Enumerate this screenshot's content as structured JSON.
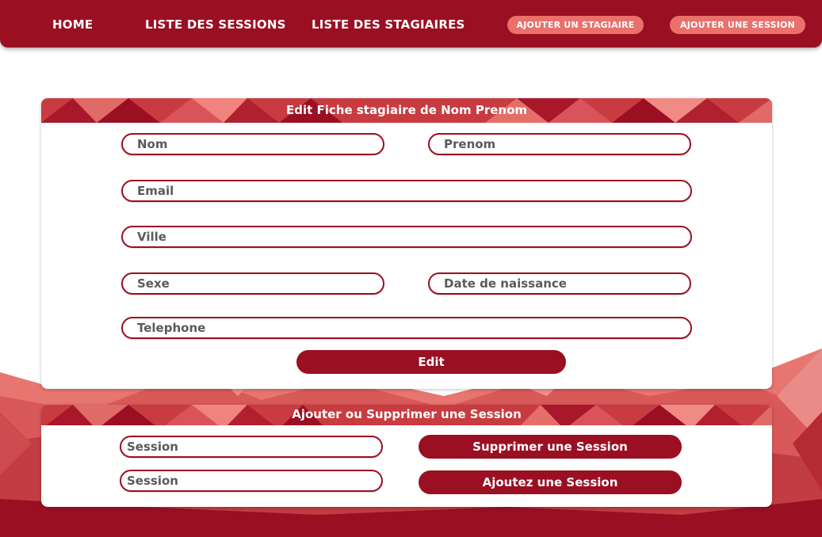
{
  "nav": {
    "home": "HOME",
    "sessions": "LISTE DES SESSIONS",
    "stagiaires": "LISTE DES STAGIAIRES",
    "add_stagiaire": "AJOUTER UN STAGIAIRE",
    "add_session": "AJOUTER UNE SESSION"
  },
  "edit_card": {
    "title": "Edit Fiche stagiaire de Nom Prenom",
    "fields": {
      "nom": "Nom",
      "prenom": "Prenom",
      "email": "Email",
      "ville": "Ville",
      "sexe": "Sexe",
      "date_naissance": "Date de naissance",
      "telephone": "Telephone"
    },
    "edit_button": "Edit"
  },
  "session_card": {
    "title": "Ajouter ou Supprimer une Session",
    "session_field_1": "Session",
    "session_field_2": "Session",
    "delete_button": "Supprimer une Session",
    "add_button": "Ajoutez une Session"
  },
  "colors": {
    "primary": "#9b0f22",
    "accent": "#e9706b",
    "header_band": "#c83b40"
  }
}
